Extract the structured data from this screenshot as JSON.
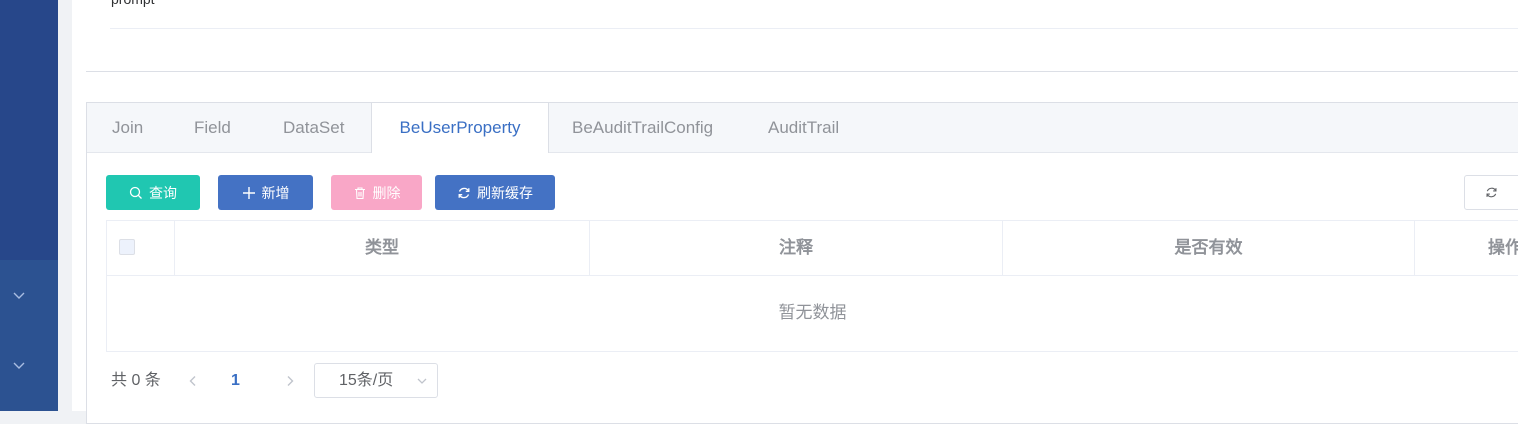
{
  "form": {
    "prompt_label": "prompt"
  },
  "tabs": [
    {
      "label": "Join"
    },
    {
      "label": "Field"
    },
    {
      "label": "DataSet"
    },
    {
      "label": "BeUserProperty"
    },
    {
      "label": "BeAuditTrailConfig"
    },
    {
      "label": "AuditTrail"
    }
  ],
  "active_tab": "BeUserProperty",
  "toolbar": {
    "query_label": "查询",
    "add_label": "新增",
    "delete_label": "删除",
    "refresh_cache_label": "刷新缓存"
  },
  "table": {
    "columns": [
      "类型",
      "注释",
      "是否有效",
      "操作"
    ],
    "empty_text": "暂无数据"
  },
  "pagination": {
    "total_text": "共 0 条",
    "current_page": "1",
    "page_size": "15条/页"
  },
  "colors": {
    "accent": "#4472c4",
    "query": "#20c7b1",
    "delete": "#f9a7c7",
    "sidebar": "#2c5291"
  }
}
